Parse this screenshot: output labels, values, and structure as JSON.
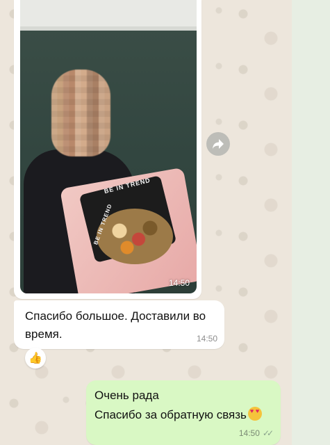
{
  "messages": {
    "photo": {
      "time": "14:50",
      "brand_text": "BE IN TREND",
      "brand_text_2": "BE IN TREND"
    },
    "incoming": {
      "text": "Спасибо большое. Доставили во время.",
      "time": "14:50",
      "reaction": "👍"
    },
    "outgoing": {
      "line1": "Очень рада",
      "line2": "Спасибо за обратную связь",
      "emoji": "heart-eyes-emoji",
      "time": "14:50",
      "status": "read"
    }
  },
  "icons": {
    "forward": "forward-icon",
    "read_receipt": "double-check-icon"
  },
  "colors": {
    "incoming_bubble": "#ffffff",
    "outgoing_bubble": "#d9f8c4",
    "chat_background": "#ede6dc"
  }
}
